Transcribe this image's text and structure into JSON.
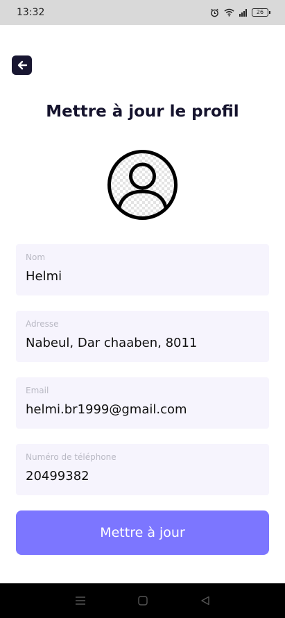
{
  "status_bar": {
    "time": "13:32",
    "battery": "26",
    "icons": [
      "alarm-icon",
      "wifi-icon",
      "signal-icon",
      "battery-icon"
    ]
  },
  "header": {
    "back_icon": "arrow-left-icon",
    "title": "Mettre à jour le profil"
  },
  "avatar": {
    "icon": "user-avatar-icon"
  },
  "form": {
    "name": {
      "label": "Nom",
      "value": "Helmi"
    },
    "address": {
      "label": "Adresse",
      "value": "Nabeul, Dar chaaben, 8011"
    },
    "email": {
      "label": "Email",
      "value": "helmi.br1999@gmail.com"
    },
    "phone": {
      "label": "Numéro de téléphone",
      "value": "20499382"
    },
    "submit_label": "Mettre à jour"
  },
  "nav_bar": {
    "icons": [
      "menu-icon",
      "home-icon",
      "back-triangle-icon"
    ]
  },
  "colors": {
    "primary": "#7c76ff",
    "dark": "#181631",
    "field_bg": "#f6f4fd"
  }
}
